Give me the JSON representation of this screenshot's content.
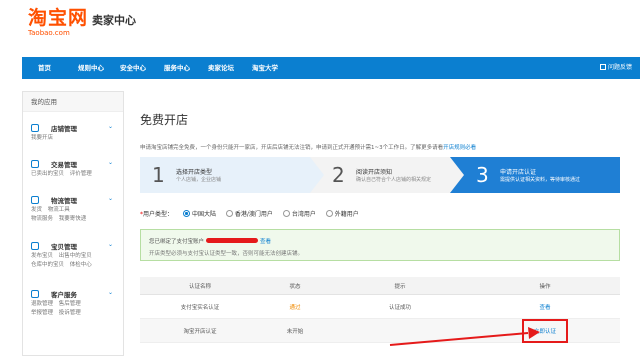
{
  "header": {
    "logo_main": "淘宝网",
    "logo_sub": "Taobao.com",
    "center_title": "卖家中心"
  },
  "nav": {
    "items": [
      "首页",
      "规则中心",
      "安全中心",
      "服务中心",
      "卖家论坛",
      "淘宝大学"
    ],
    "help": "问题反馈"
  },
  "sidebar": {
    "title": "我的应用",
    "groups": [
      {
        "title": "店铺管理",
        "links": [
          "我要开店"
        ]
      },
      {
        "title": "交易管理",
        "links": [
          "已卖出的宝贝",
          "评价管理"
        ]
      },
      {
        "title": "物流管理",
        "links": [
          "发货",
          "物流工具",
          "物流服务",
          "我要寄快递"
        ]
      },
      {
        "title": "宝贝管理",
        "links": [
          "发布宝贝",
          "出售中的宝贝",
          "仓库中的宝贝",
          "体检中心"
        ]
      },
      {
        "title": "客户服务",
        "links": [
          "退款管理",
          "售后管理",
          "举报管理",
          "投诉管理"
        ]
      }
    ]
  },
  "main": {
    "title": "免费开店",
    "notice_text": "申请淘宝店铺完全免费，一个身份只能开一家店，开店后店铺无法注销，申请到正式开通预计需1~3个工作日。了解更多请看",
    "notice_link": "开店规则必看",
    "steps": [
      {
        "num": "1",
        "title": "选择开店类型",
        "sub": "个人店铺，企业店铺"
      },
      {
        "num": "2",
        "title": "阅读开店须知",
        "sub": "确认自己符合个人店铺的相关规定"
      },
      {
        "num": "3",
        "title": "申请开店认证",
        "sub": "需提供认证相关资料，等待审核通过"
      }
    ],
    "usertype": {
      "label": "用户类型：",
      "options": [
        "中国大陆",
        "香港/澳门用户",
        "台湾用户",
        "外籍用户"
      ],
      "selected": "中国大陆"
    },
    "greenbox": {
      "line1_prefix": "您已绑定了支付宝账户",
      "line1_link": "查看",
      "line2": "开店类型必须与支付宝认证类型一致，否则可能无法创建店铺。"
    },
    "table": {
      "headers": [
        "认证名称",
        "状态",
        "提示",
        "操作"
      ],
      "rows": [
        {
          "name": "支付宝实名认证",
          "status": "通过",
          "tip": "认证成功",
          "action": "查看"
        },
        {
          "name": "淘宝开店认证",
          "status": "未开始",
          "tip": "",
          "action": "立即认证"
        }
      ]
    }
  },
  "colors": {
    "brand": "#ff5000",
    "nav": "#0b7fd0",
    "active_step": "#1f7fd4",
    "annotation_red": "#e51a1a"
  }
}
